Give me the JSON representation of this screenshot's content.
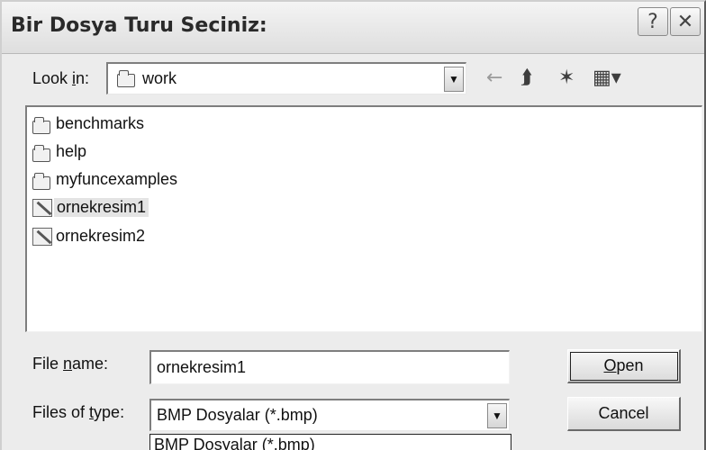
{
  "dialog": {
    "title": "Bir Dosya Turu Seciniz:"
  },
  "titlebar": {
    "help_glyph": "?",
    "close_glyph": "✕"
  },
  "lookin": {
    "label_pre": "Look ",
    "label_u": "i",
    "label_post": "n:",
    "value": "work"
  },
  "toolbar": {
    "back_icon": "←",
    "up_icon": "⮭",
    "new_folder_icon": "✶",
    "view_icon": "▦▾"
  },
  "files": [
    {
      "name": "benchmarks",
      "kind": "folder"
    },
    {
      "name": "help",
      "kind": "folder"
    },
    {
      "name": "myfuncexamples",
      "kind": "folder"
    },
    {
      "name": "ornekresim1",
      "kind": "image",
      "selected": true
    },
    {
      "name": "ornekresim2",
      "kind": "image"
    }
  ],
  "filename": {
    "label_pre": "File ",
    "label_u": "n",
    "label_post": "ame:",
    "value": "ornekresim1"
  },
  "filetype": {
    "label_pre": "Files of ",
    "label_u": "t",
    "label_post": "ype:",
    "value": "BMP Dosyalar (*.bmp)",
    "dropdown_option": "BMP Dosyalar (*.bmp)"
  },
  "buttons": {
    "open_u": "O",
    "open_rest": "pen",
    "cancel": "Cancel"
  },
  "colors": {
    "dialog_bg": "#ececec",
    "selection_bg": "#e4e4e4",
    "list_bg": "#ffffff"
  }
}
